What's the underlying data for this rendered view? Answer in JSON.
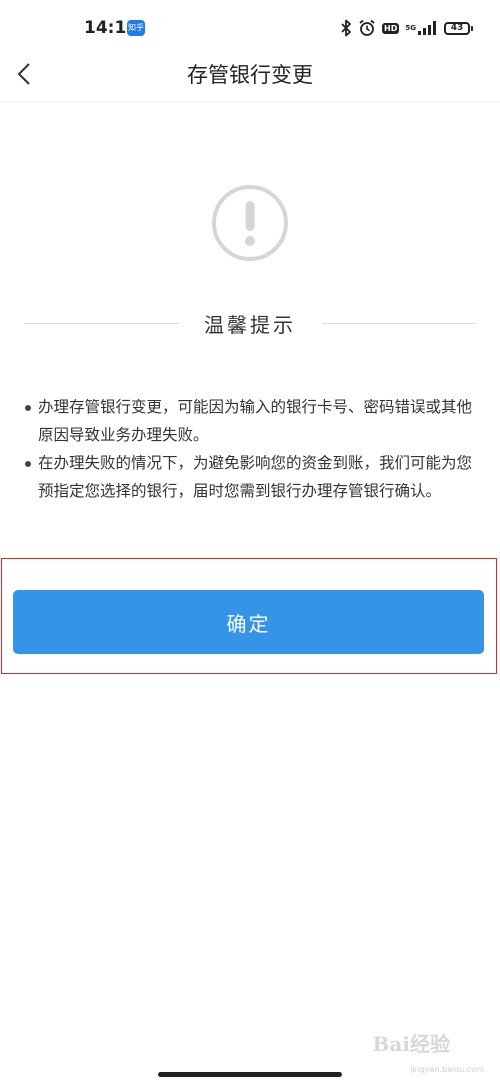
{
  "status_bar": {
    "time": "14:19",
    "app_badge": "知乎",
    "hd": "HD",
    "network": "5G",
    "battery": "43",
    "icons": [
      "bluetooth-icon",
      "alarm-icon",
      "hd-icon",
      "signal-icon",
      "battery-icon"
    ]
  },
  "header": {
    "title": "存管银行变更",
    "back_icon": "chevron-left-icon"
  },
  "notice": {
    "icon": "exclamation-circle-icon",
    "heading": "温馨提示",
    "items": [
      "办理存管银行变更，可能因为输入的银行卡号、密码错误或其他原因导致业务办理失败。",
      "在办理失败的情况下，为避免影响您的资金到账，我们可能为您预指定您选择的银行，届时您需到银行办理存管银行确认。"
    ]
  },
  "actions": {
    "confirm_label": "确定"
  },
  "colors": {
    "primary": "#3495e8",
    "highlight_border": "#e0262e",
    "icon_gray": "#d6d6d6"
  },
  "watermark": {
    "logo": "Bai经验",
    "url": "jingyan.baidu.com"
  }
}
